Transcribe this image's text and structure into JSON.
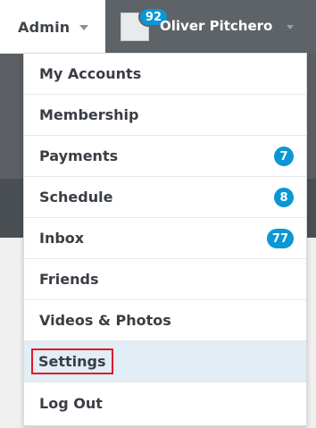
{
  "header": {
    "admin_label": "Admin",
    "user_name": "Oliver Pitchero",
    "user_badge": "92"
  },
  "menu": {
    "items": [
      {
        "label": "My Accounts",
        "count": null
      },
      {
        "label": "Membership",
        "count": null
      },
      {
        "label": "Payments",
        "count": "7"
      },
      {
        "label": "Schedule",
        "count": "8"
      },
      {
        "label": "Inbox",
        "count": "77"
      },
      {
        "label": "Friends",
        "count": null
      },
      {
        "label": "Videos & Photos",
        "count": null
      },
      {
        "label": "Settings",
        "count": null,
        "highlighted": true
      },
      {
        "label": "Log Out",
        "count": null
      }
    ]
  },
  "colors": {
    "badge": "#0b97d4",
    "highlight_outline": "#e01a23",
    "active_row_bg": "#e2edf5",
    "user_bar_bg": "#5e6368"
  }
}
